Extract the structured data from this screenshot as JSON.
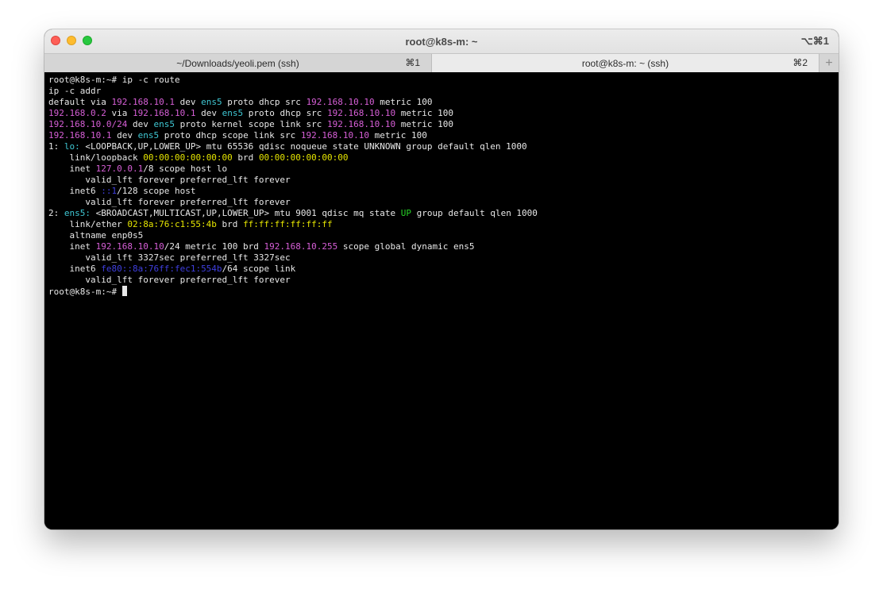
{
  "window": {
    "title": "root@k8s-m: ~",
    "shortcut": "⌥⌘1"
  },
  "tabs": [
    {
      "label": "~/Downloads/yeoli.pem (ssh)",
      "shortcut": "⌘1"
    },
    {
      "label": "root@k8s-m: ~ (ssh)",
      "shortcut": "⌘2"
    }
  ],
  "tab_add_label": "+",
  "colors": {
    "magenta": "#d75fd7",
    "cyan": "#3fc7d3",
    "yellow": "#e5e500",
    "green": "#27d327",
    "blue": "#3f3fe0",
    "text": "#e8e8e8",
    "background": "#000000"
  },
  "terminal": {
    "prompt": "root@k8s-m:~# ",
    "lines": [
      [
        {
          "t": "root@k8s-m:~# ip -c route"
        }
      ],
      [
        {
          "t": "ip -c addr"
        }
      ],
      [
        {
          "t": "default via "
        },
        {
          "t": "192.168.10.1",
          "c": "mag"
        },
        {
          "t": " dev "
        },
        {
          "t": "ens5",
          "c": "cyan"
        },
        {
          "t": " proto dhcp src "
        },
        {
          "t": "192.168.10.10",
          "c": "mag"
        },
        {
          "t": " metric 100"
        }
      ],
      [
        {
          "t": "192.168.0.2",
          "c": "mag"
        },
        {
          "t": " via "
        },
        {
          "t": "192.168.10.1",
          "c": "mag"
        },
        {
          "t": " dev "
        },
        {
          "t": "ens5",
          "c": "cyan"
        },
        {
          "t": " proto dhcp src "
        },
        {
          "t": "192.168.10.10",
          "c": "mag"
        },
        {
          "t": " metric 100"
        }
      ],
      [
        {
          "t": "192.168.10.0/24",
          "c": "mag"
        },
        {
          "t": " dev "
        },
        {
          "t": "ens5",
          "c": "cyan"
        },
        {
          "t": " proto kernel scope link src "
        },
        {
          "t": "192.168.10.10",
          "c": "mag"
        },
        {
          "t": " metric 100"
        }
      ],
      [
        {
          "t": "192.168.10.1",
          "c": "mag"
        },
        {
          "t": " dev "
        },
        {
          "t": "ens5",
          "c": "cyan"
        },
        {
          "t": " proto dhcp scope link src "
        },
        {
          "t": "192.168.10.10",
          "c": "mag"
        },
        {
          "t": " metric 100"
        }
      ],
      [
        {
          "t": "1: "
        },
        {
          "t": "lo:",
          "c": "cyan"
        },
        {
          "t": " <LOOPBACK,UP,LOWER_UP> mtu 65536 qdisc noqueue state UNKNOWN group default qlen 1000"
        }
      ],
      [
        {
          "t": "    link/loopback "
        },
        {
          "t": "00:00:00:00:00:00",
          "c": "yel"
        },
        {
          "t": " brd "
        },
        {
          "t": "00:00:00:00:00:00",
          "c": "yel"
        }
      ],
      [
        {
          "t": "    inet "
        },
        {
          "t": "127.0.0.1",
          "c": "mag"
        },
        {
          "t": "/8 scope host lo"
        }
      ],
      [
        {
          "t": "       valid_lft forever preferred_lft forever"
        }
      ],
      [
        {
          "t": "    inet6 "
        },
        {
          "t": "::1",
          "c": "blue"
        },
        {
          "t": "/128 scope host"
        }
      ],
      [
        {
          "t": "       valid_lft forever preferred_lft forever"
        }
      ],
      [
        {
          "t": "2: "
        },
        {
          "t": "ens5:",
          "c": "cyan"
        },
        {
          "t": " <BROADCAST,MULTICAST,UP,LOWER_UP> mtu 9001 qdisc mq state "
        },
        {
          "t": "UP",
          "c": "green"
        },
        {
          "t": " group default qlen 1000"
        }
      ],
      [
        {
          "t": "    link/ether "
        },
        {
          "t": "02:8a:76:c1:55:4b",
          "c": "yel"
        },
        {
          "t": " brd "
        },
        {
          "t": "ff:ff:ff:ff:ff:ff",
          "c": "yel"
        }
      ],
      [
        {
          "t": "    altname enp0s5"
        }
      ],
      [
        {
          "t": "    inet "
        },
        {
          "t": "192.168.10.10",
          "c": "mag"
        },
        {
          "t": "/24 metric 100 brd "
        },
        {
          "t": "192.168.10.255",
          "c": "mag"
        },
        {
          "t": " scope global dynamic ens5"
        }
      ],
      [
        {
          "t": "       valid_lft 3327sec preferred_lft 3327sec"
        }
      ],
      [
        {
          "t": "    inet6 "
        },
        {
          "t": "fe80::8a:76ff:fec1:554b",
          "c": "blue"
        },
        {
          "t": "/64 scope link"
        }
      ],
      [
        {
          "t": "       valid_lft forever preferred_lft forever"
        }
      ]
    ]
  }
}
